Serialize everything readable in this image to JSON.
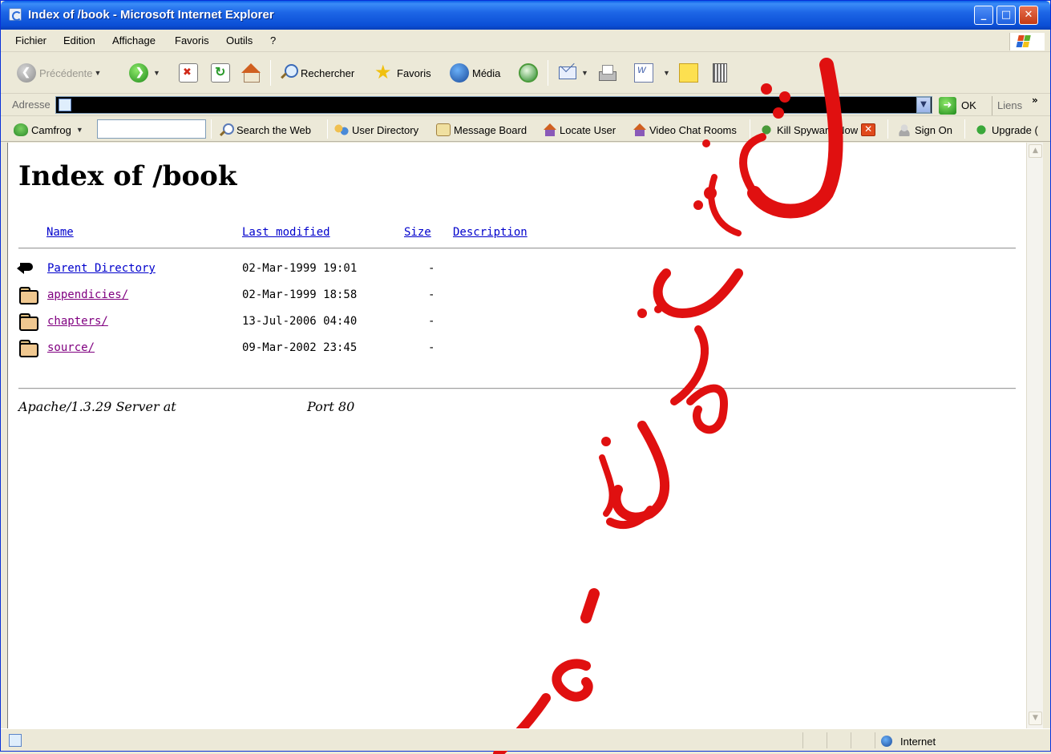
{
  "window": {
    "title": "Index of /book - Microsoft Internet Explorer",
    "minimize": "_",
    "maximize": "□",
    "close": "✕"
  },
  "menu": [
    "Fichier",
    "Edition",
    "Affichage",
    "Favoris",
    "Outils",
    "?"
  ],
  "toolbar": {
    "back_label": "Précédente",
    "search_label": "Rechercher",
    "favorites_label": "Favoris",
    "media_label": "Média"
  },
  "address": {
    "label": "Adresse",
    "go_label": "OK",
    "links_label": "Liens",
    "chevron": "»"
  },
  "links_toolbar": {
    "camfrog": "Camfrog",
    "search_web": "Search the Web",
    "user_directory": "User Directory",
    "message_board": "Message Board",
    "locate_user": "Locate User",
    "video_chat": "Video Chat Rooms",
    "kill_spyware": "Kill Spyware Now",
    "sign_on": "Sign On",
    "upgrade": "Upgrade ("
  },
  "page": {
    "title": "Index of /book",
    "columns": {
      "name": "Name",
      "last_modified": "Last modified",
      "size": "Size",
      "description": "Description"
    },
    "rows": [
      {
        "name": "Parent Directory",
        "modified": "02-Mar-1999 19:01",
        "size": "-"
      },
      {
        "name": "appendicies/",
        "modified": "02-Mar-1999 18:58",
        "size": "-"
      },
      {
        "name": "chapters/",
        "modified": "13-Jul-2006 04:40",
        "size": "-"
      },
      {
        "name": "source/",
        "modified": "09-Mar-2002 23:45",
        "size": "-"
      }
    ],
    "server_signature": "Apache/1.3.29 Server at",
    "server_port": "Port 80"
  },
  "status": {
    "zone": "Internet"
  },
  "colors": {
    "titlebar": "#0a4fd6",
    "link": "#0000cc",
    "visited": "#800080",
    "watermark": "#e01010"
  }
}
